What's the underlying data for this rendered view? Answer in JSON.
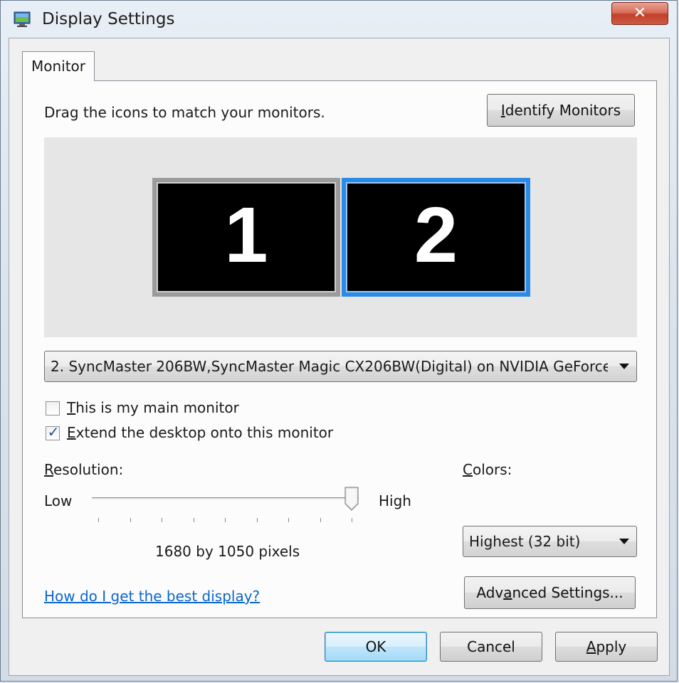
{
  "window": {
    "title": "Display Settings",
    "close_glyph": "✕",
    "icon": "display-settings-icon"
  },
  "tabs": [
    {
      "label": "Monitor",
      "active": true
    }
  ],
  "monitor_tab": {
    "instruction": "Drag the icons to match your monitors.",
    "identify_button": {
      "pre": "",
      "accel": "I",
      "post": "dentify Monitors"
    },
    "monitors": [
      {
        "number": "1",
        "selected": false
      },
      {
        "number": "2",
        "selected": true
      }
    ],
    "monitor_select": {
      "value": "2. SyncMaster 206BW,SyncMaster Magic CX206BW(Digital) on NVIDIA GeForce"
    },
    "main_monitor_checkbox": {
      "accel": "T",
      "rest": "his is my main monitor",
      "checked": false
    },
    "extend_checkbox": {
      "accel": "E",
      "rest": "xtend the desktop onto this monitor",
      "checked": true,
      "check_glyph": "✓"
    },
    "resolution": {
      "label_accel": "R",
      "label_rest": "esolution:",
      "low_label": "Low",
      "high_label": "High",
      "value_text": "1680 by 1050 pixels",
      "slider_fraction": 1.0,
      "tick_count": 9
    },
    "colors": {
      "label_accel": "C",
      "label_rest": "olors:",
      "value": "Highest (32 bit)"
    },
    "help_link": "How do I get the best display?",
    "advanced_button": {
      "pre": "Adv",
      "accel": "a",
      "post": "nced Settings..."
    }
  },
  "footer": {
    "ok_label": "OK",
    "cancel_label": "Cancel",
    "apply_accel": "A",
    "apply_rest": "pply"
  },
  "colors_palette": {
    "selected_monitor_border": "#2a8ae6",
    "link": "#0a66cc",
    "close_button": "#c0402b"
  }
}
